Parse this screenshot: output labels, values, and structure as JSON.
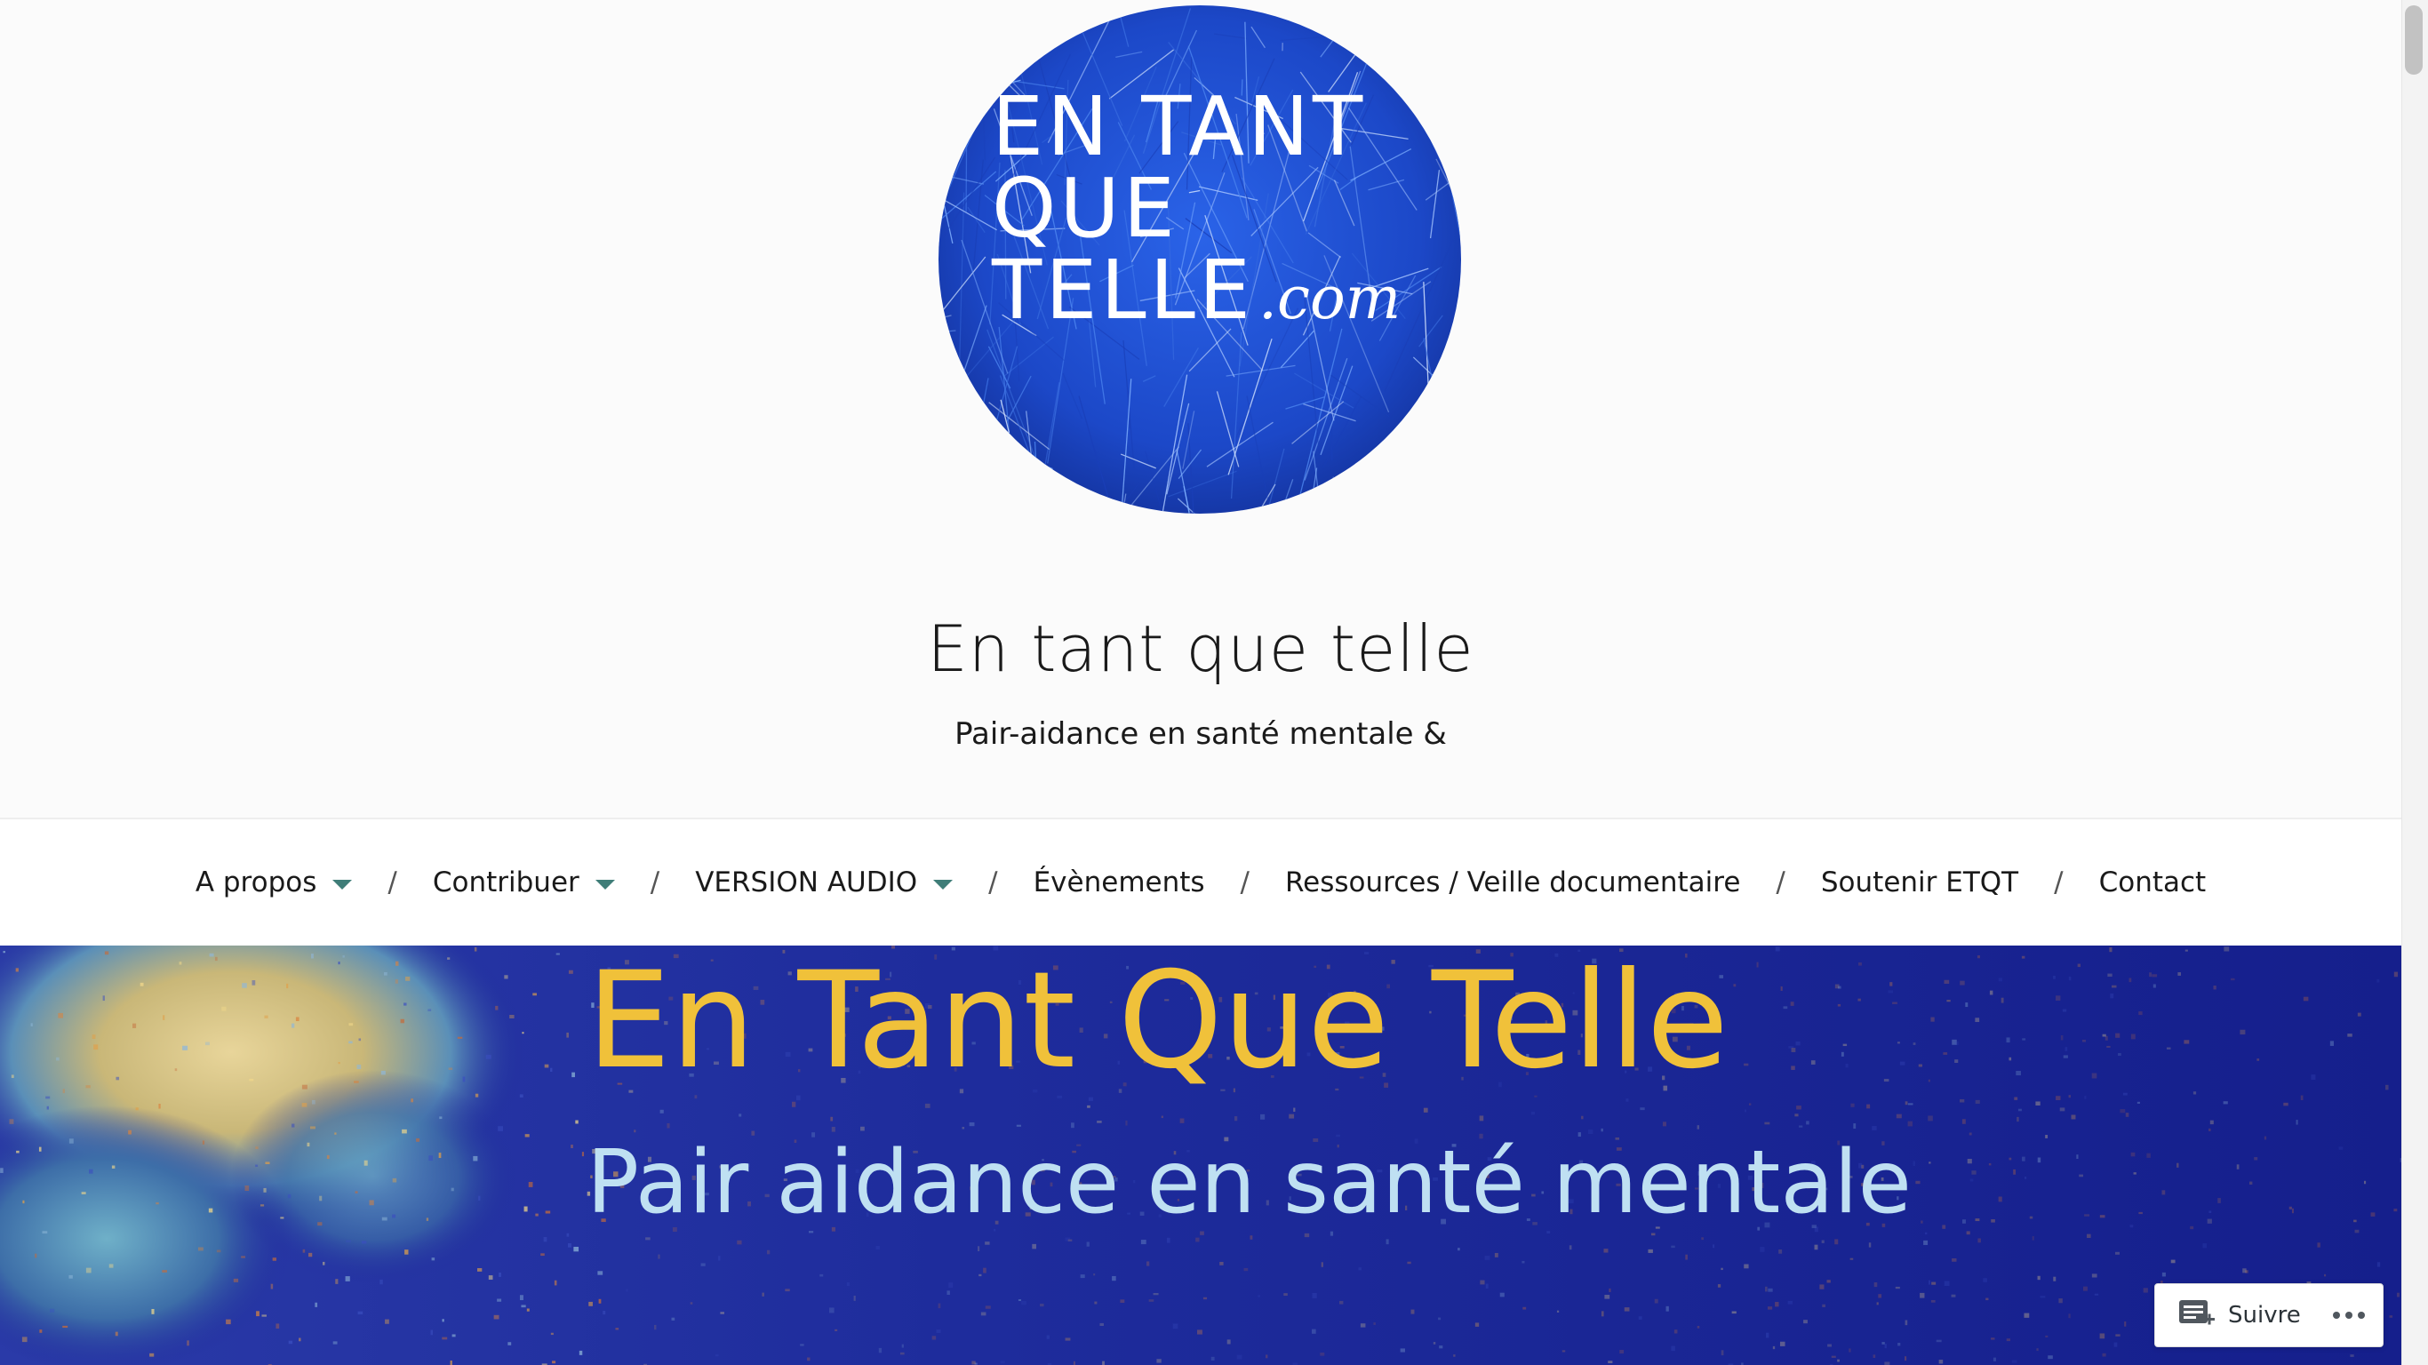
{
  "header": {
    "logo_lines": [
      "EN TANT",
      "QUE",
      "TELLE"
    ],
    "logo_suffix": ".com",
    "site_title": "En tant que telle",
    "site_description": "Pair-aidance en santé mentale &"
  },
  "nav": {
    "items": [
      {
        "label": "A propos",
        "has_dropdown": true
      },
      {
        "label": "Contribuer",
        "has_dropdown": true
      },
      {
        "label": "VERSION AUDIO",
        "has_dropdown": true
      },
      {
        "label": "Évènements",
        "has_dropdown": false
      },
      {
        "label": "Ressources / Veille documentaire",
        "has_dropdown": false
      },
      {
        "label": "Soutenir ETQT",
        "has_dropdown": false
      },
      {
        "label": "Contact",
        "has_dropdown": false
      }
    ],
    "separator": "/",
    "caret_color": "#3f7d78"
  },
  "banner": {
    "title": "En Tant Que Telle",
    "subtitle": "Pair aidance en santé mentale",
    "title_color": "#f0c13a",
    "subtitle_color": "#bfe0f2",
    "background_color": "#1f2a9a"
  },
  "follow_widget": {
    "follow_label": "Suivre",
    "icon": "reader-follow-icon",
    "more_icon": "ellipsis-icon"
  },
  "colors": {
    "logo_blue": "#1f4fd6"
  }
}
